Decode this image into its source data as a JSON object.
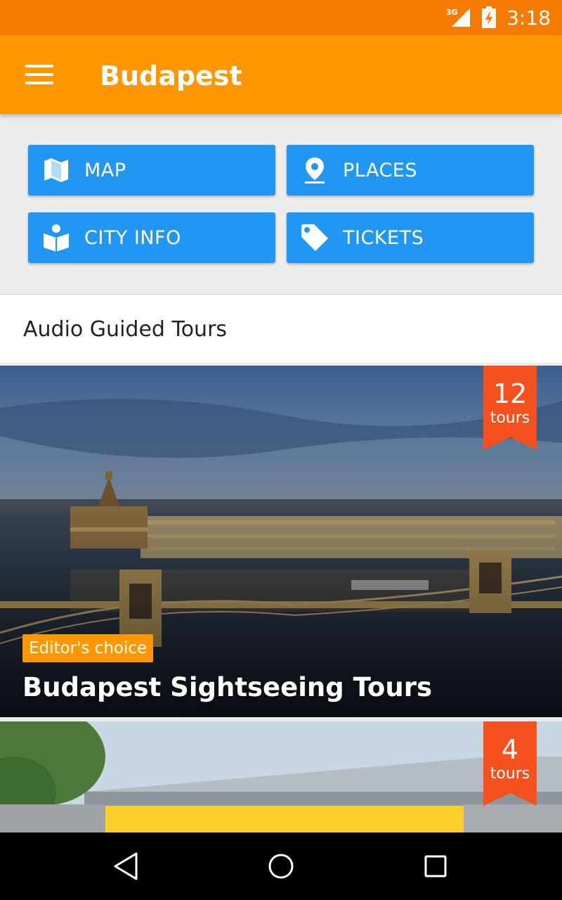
{
  "status_bar": {
    "network": "3G",
    "time": "3:18"
  },
  "app_bar": {
    "title": "Budapest"
  },
  "buttons": [
    {
      "label": "MAP",
      "icon": "map-icon"
    },
    {
      "label": "PLACES",
      "icon": "place-pin-icon"
    },
    {
      "label": "CITY INFO",
      "icon": "city-info-icon"
    },
    {
      "label": "TICKETS",
      "icon": "ticket-tag-icon"
    }
  ],
  "section": {
    "title": "Audio Guided Tours"
  },
  "tours": [
    {
      "count": "12",
      "unit": "tours",
      "chip": "Editor's choice",
      "title": "Budapest Sightseeing Tours"
    },
    {
      "count": "4",
      "unit": "tours"
    }
  ],
  "colors": {
    "status_bar": "#f57c00",
    "app_bar": "#ff9800",
    "button": "#2196f3",
    "badge": "#f4511e",
    "chip": "#ff9800"
  }
}
